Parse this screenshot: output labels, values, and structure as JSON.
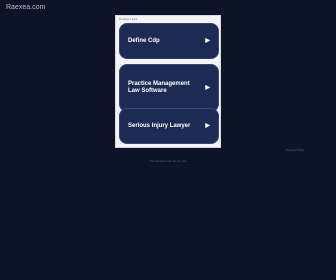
{
  "site": {
    "domain": "Raexea.com"
  },
  "ad_panel": {
    "header": "Related Links",
    "cards": [
      {
        "label": "Define Cdp",
        "arrow": "▶"
      },
      {
        "label": "Practice Management Law Software",
        "arrow": "▶"
      },
      {
        "label": "Serious Injury Lawyer",
        "arrow": "▶"
      }
    ]
  },
  "footer": {
    "privacy": "Privacy Policy",
    "disclaimer": "This domain may be for sale"
  },
  "colors": {
    "page_background": "#0d1328",
    "card_background": "#1d2b54",
    "panel_background": "#f4f4f4"
  }
}
